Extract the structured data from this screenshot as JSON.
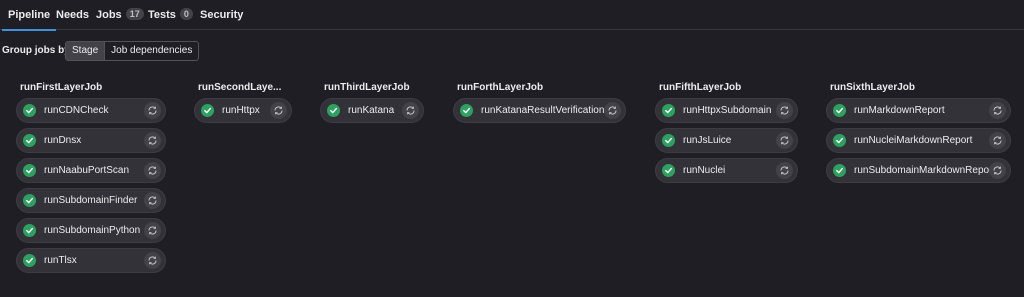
{
  "tabs": [
    {
      "label": "Pipeline",
      "active": true
    },
    {
      "label": "Needs"
    },
    {
      "label": "Jobs",
      "count": "17"
    },
    {
      "label": "Tests",
      "count": "0"
    },
    {
      "label": "Security"
    }
  ],
  "group_by": {
    "label": "Group jobs by",
    "options": [
      "Stage",
      "Job dependencies"
    ],
    "selected": "Stage"
  },
  "stages": [
    {
      "title": "runFirstLayerJob",
      "jobs": [
        "runCDNCheck",
        "runDnsx",
        "runNaabuPortScan",
        "runSubdomainFinder",
        "runSubdomainPython",
        "runTlsx"
      ]
    },
    {
      "title": "runSecondLaye...",
      "jobs": [
        "runHttpx"
      ]
    },
    {
      "title": "runThirdLayerJob",
      "jobs": [
        "runKatana"
      ]
    },
    {
      "title": "runForthLayerJob",
      "jobs": [
        "runKatanaResultVerification"
      ]
    },
    {
      "title": "runFifthLayerJob",
      "jobs": [
        "runHttpxSubdomain",
        "runJsLuice",
        "runNuclei"
      ]
    },
    {
      "title": "runSixthLayerJob",
      "jobs": [
        "runMarkdownReport",
        "runNucleiMarkdownReport",
        "runSubdomainMarkdownReport"
      ]
    }
  ],
  "job_status": "passed",
  "colors": {
    "accent": "#428fdc",
    "success": "#2da160"
  },
  "icons": {
    "status": "check-circle-icon",
    "retry": "retry-icon"
  }
}
